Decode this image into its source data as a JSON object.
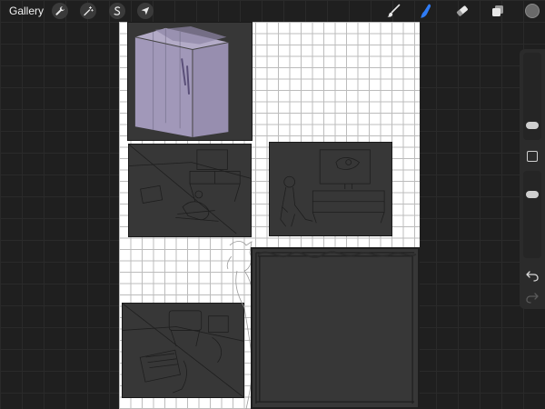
{
  "topbar": {
    "gallery_label": "Gallery",
    "left_tools": [
      {
        "name": "actions",
        "icon": "wrench-icon"
      },
      {
        "name": "adjustments",
        "icon": "magic-wand-icon"
      },
      {
        "name": "selection",
        "icon": "selection-s-icon"
      },
      {
        "name": "transform",
        "icon": "arrow-cursor-icon"
      }
    ],
    "right_tools": [
      {
        "name": "brush",
        "icon": "brush-icon",
        "active": false
      },
      {
        "name": "smudge",
        "icon": "smudge-finger-icon",
        "active": true
      },
      {
        "name": "eraser",
        "icon": "eraser-icon",
        "active": false
      },
      {
        "name": "layers",
        "icon": "layers-icon",
        "active": false
      }
    ],
    "current_color": "#6a6a6a"
  },
  "sidebar": {
    "brush_size_level": 0.5,
    "opacity_level": 0.65,
    "modify_icon": "square-icon",
    "undo_icon": "undo-arrow-icon",
    "redo_icon": "redo-arrow-icon"
  },
  "colors": {
    "active_tool": "#2f7cf6",
    "panel_fill": "#373737",
    "sketch_purple": "#b4a9d0",
    "canvas_grid": "#bcbcbc"
  }
}
